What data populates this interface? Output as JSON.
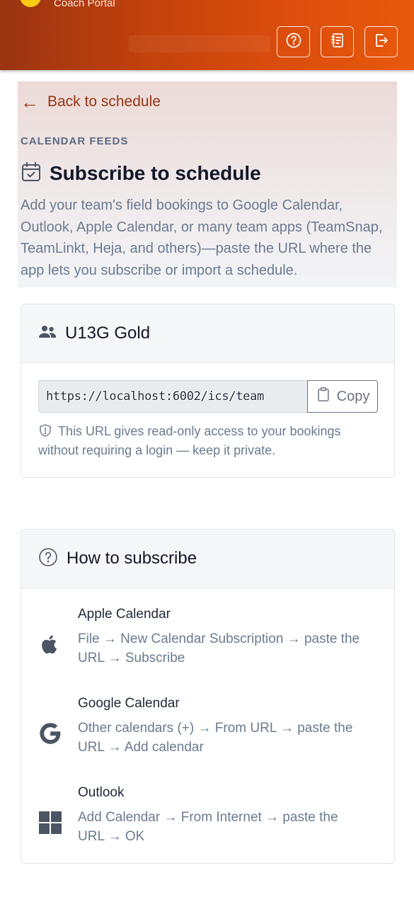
{
  "header": {
    "brand_title": "Coach Portal",
    "buttons": [
      {
        "icon": "help-circle-icon",
        "label": "Help"
      },
      {
        "icon": "notebook-icon",
        "label": "Notes"
      },
      {
        "icon": "logout-icon",
        "label": "Log out"
      }
    ]
  },
  "intro": {
    "back_link": "Back to schedule",
    "eyebrow": "CALENDAR FEEDS",
    "title": "Subscribe to schedule",
    "description": "Add your team's field bookings to Google Calendar, Outlook, Apple Calendar, or many team apps (TeamSnap, TeamLinkt, Heja, and others)—paste the URL where the app lets you subscribe or import a schedule."
  },
  "team_card": {
    "team_name": "U13G Gold",
    "feed_url": "https://localhost:6002/ics/team",
    "copy_label": "Copy",
    "note": "This URL gives read-only access to your bookings without requiring a login — keep it private."
  },
  "howto_card": {
    "title": "How to subscribe",
    "items": [
      {
        "name": "Apple Calendar",
        "icon": "apple-icon",
        "steps": "File → New Calendar Subscription → paste the URL → Subscribe"
      },
      {
        "name": "Google Calendar",
        "icon": "google-icon",
        "steps": "Other calendars (+) → From URL → paste the URL → Add calendar"
      },
      {
        "name": "Outlook",
        "icon": "windows-icon",
        "steps": "Add Calendar → From Internet → paste the URL → OK"
      }
    ]
  },
  "colors": {
    "header_start": "#9a3412",
    "header_end": "#e8580c",
    "accent_link": "#9a3412",
    "muted_text": "#6b7b90"
  }
}
